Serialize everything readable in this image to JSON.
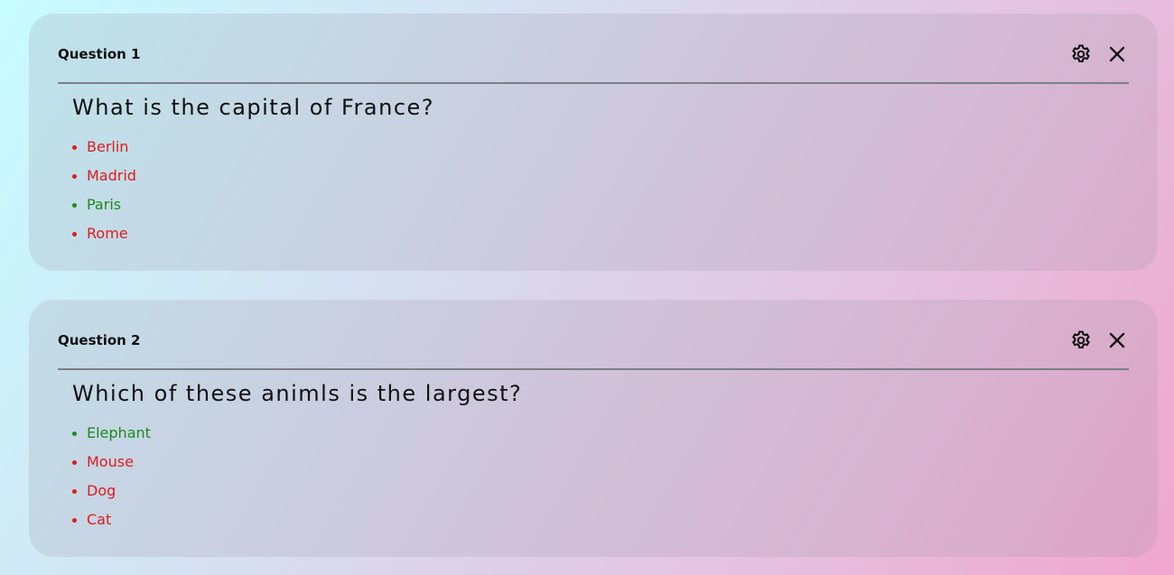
{
  "colors": {
    "correct": "#1f8a1f",
    "incorrect": "#e01b1b",
    "text": "#111111",
    "divider": "#7c7f86"
  },
  "questions": [
    {
      "label": "Question 1",
      "text": "What is the capital of France?",
      "icons": {
        "settings": "gear-icon",
        "close": "close-icon"
      },
      "answers": [
        {
          "text": "Berlin",
          "correct": false
        },
        {
          "text": "Madrid",
          "correct": false
        },
        {
          "text": "Paris",
          "correct": true
        },
        {
          "text": "Rome",
          "correct": false
        }
      ]
    },
    {
      "label": "Question 2",
      "text": "Which of these animls is the largest?",
      "icons": {
        "settings": "gear-icon",
        "close": "close-icon"
      },
      "answers": [
        {
          "text": "Elephant",
          "correct": true
        },
        {
          "text": "Mouse",
          "correct": false
        },
        {
          "text": "Dog",
          "correct": false
        },
        {
          "text": "Cat",
          "correct": false
        }
      ]
    }
  ]
}
